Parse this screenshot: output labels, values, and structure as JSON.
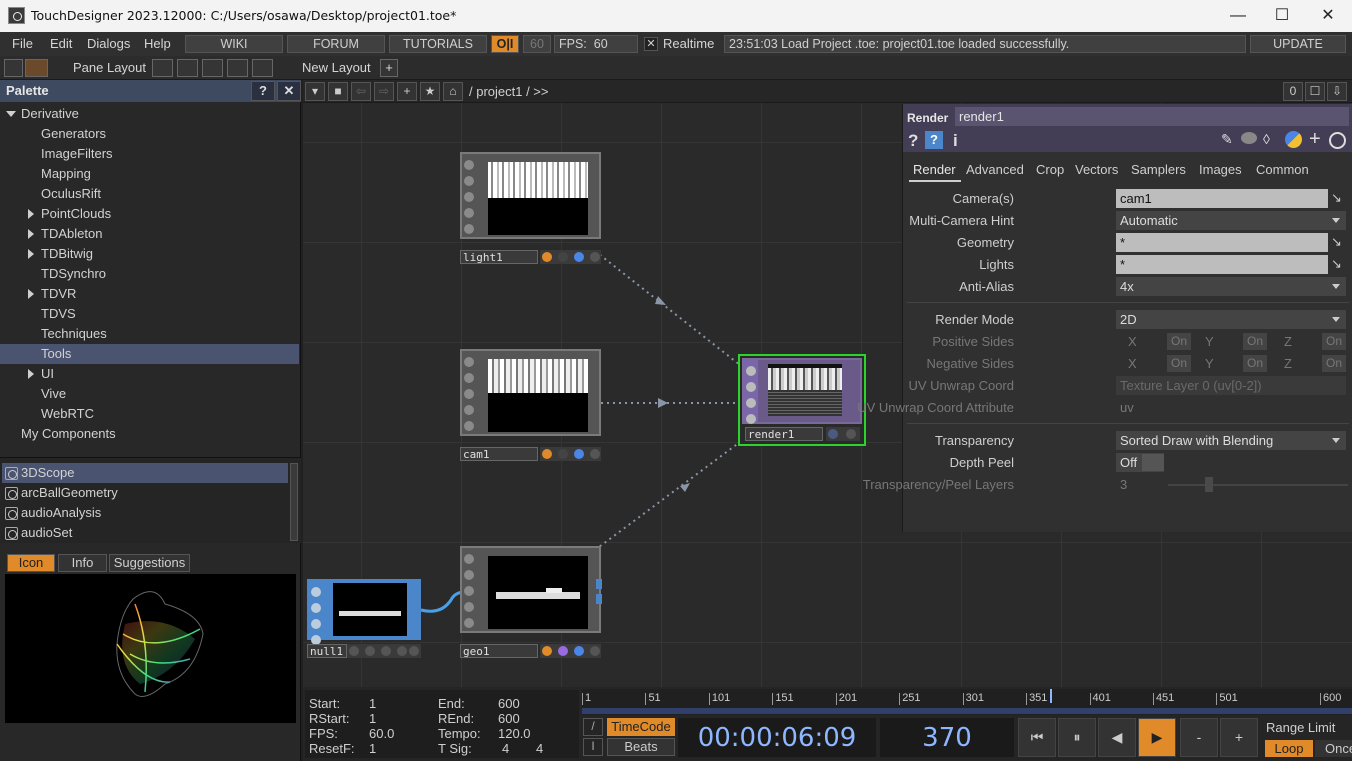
{
  "window": {
    "title": "TouchDesigner 2023.12000: C:/Users/osawa/Desktop/project01.toe*",
    "minimize": "—",
    "maximize": "☐",
    "close": "✕"
  },
  "menubar": {
    "items": [
      "File",
      "Edit",
      "Dialogs",
      "Help"
    ],
    "wiki": "WIKI",
    "forum": "FORUM",
    "tutorials": "TUTORIALS",
    "oi": "O|I",
    "fps_cap": "60",
    "fps_label": "FPS:",
    "fps_value": "60",
    "realtime_check": "✕",
    "realtime": "Realtime",
    "status": "23:51:03 Load Project .toe: project01.toe loaded successfully.",
    "update": "UPDATE"
  },
  "paneline": {
    "pane_layout": "Pane Layout",
    "new_layout": "New Layout",
    "add": "+"
  },
  "palette": {
    "title": "Palette",
    "help": "?",
    "close": "✕",
    "root": "Derivative",
    "items": [
      {
        "label": "Generators",
        "expand": false
      },
      {
        "label": "ImageFilters",
        "expand": false
      },
      {
        "label": "Mapping",
        "expand": false
      },
      {
        "label": "OculusRift",
        "expand": false
      },
      {
        "label": "PointClouds",
        "expand": true
      },
      {
        "label": "TDAbleton",
        "expand": true
      },
      {
        "label": "TDBitwig",
        "expand": true
      },
      {
        "label": "TDSynchro",
        "expand": false
      },
      {
        "label": "TDVR",
        "expand": true
      },
      {
        "label": "TDVS",
        "expand": false
      },
      {
        "label": "Techniques",
        "expand": false
      },
      {
        "label": "Tools",
        "expand": false,
        "selected": true
      },
      {
        "label": "UI",
        "expand": true
      },
      {
        "label": "Vive",
        "expand": false
      },
      {
        "label": "WebRTC",
        "expand": false
      }
    ],
    "my_components": "My Components",
    "components": [
      "3DScope",
      "arcBallGeometry",
      "audioAnalysis",
      "audioSet"
    ],
    "tabs": {
      "icon": "Icon",
      "info": "Info",
      "suggestions": "Suggestions"
    }
  },
  "network": {
    "path": "/ project1 / >>",
    "right_count": "0",
    "nodes": {
      "light": "light1",
      "cam": "cam1",
      "geo": "geo1",
      "null": "null1",
      "render": "render1"
    }
  },
  "params": {
    "op_type": "Render",
    "op_name": "render1",
    "tabs": [
      "Render",
      "Advanced",
      "Crop",
      "Vectors",
      "Samplers",
      "Images",
      "Common"
    ],
    "cameras_label": "Camera(s)",
    "cameras": "cam1",
    "multicam_label": "Multi-Camera Hint",
    "multicam": "Automatic",
    "geometry_label": "Geometry",
    "geometry": "*",
    "lights_label": "Lights",
    "lights": "*",
    "antialias_label": "Anti-Alias",
    "antialias": "4x",
    "rendermode_label": "Render Mode",
    "rendermode": "2D",
    "positive_label": "Positive Sides",
    "negative_label": "Negative Sides",
    "x": "X",
    "y": "Y",
    "z": "Z",
    "on": "On",
    "uvunwrap_label": "UV Unwrap Coord",
    "uvunwrap": "Texture Layer 0 (uv[0-2])",
    "uvattr_label": "UV Unwrap Coord Attribute",
    "uvattr": "uv",
    "transparency_label": "Transparency",
    "transparency": "Sorted Draw with Blending",
    "depthpeel_label": "Depth Peel",
    "depthpeel": "Off",
    "peellayers_label": "Transparency/Peel Layers",
    "peellayers": "3"
  },
  "timeline": {
    "start_label": "Start:",
    "start": "1",
    "end_label": "End:",
    "end": "600",
    "rstart_label": "RStart:",
    "rstart": "1",
    "rend_label": "REnd:",
    "rend": "600",
    "fps_label": "FPS:",
    "fps": "60.0",
    "tempo_label": "Tempo:",
    "tempo": "120.0",
    "resetf_label": "ResetF:",
    "resetf": "1",
    "tsig_label": "T Sig:",
    "tsig_a": "4",
    "tsig_b": "4",
    "ticks": [
      "1",
      "51",
      "101",
      "151",
      "201",
      "251",
      "301",
      "351",
      "401",
      "451",
      "501",
      "600"
    ],
    "playhead_frame": 370,
    "range_end": 600,
    "timecode_btn": "TimeCode",
    "beats_btn": "Beats",
    "timecode": "00:00:06:09",
    "frame": "370",
    "range_limit": "Range Limit",
    "loop": "Loop",
    "once": "Once",
    "btn_start": "⏮",
    "btn_pause": "⏸",
    "btn_back": "◀",
    "btn_play": "▶",
    "btn_minus": "-",
    "btn_plus": "+"
  },
  "colors": {
    "accent_orange": "#e08a2a",
    "select_green": "#2bd42b",
    "node_blue": "#4a86c9",
    "param_head": "#433e55"
  }
}
